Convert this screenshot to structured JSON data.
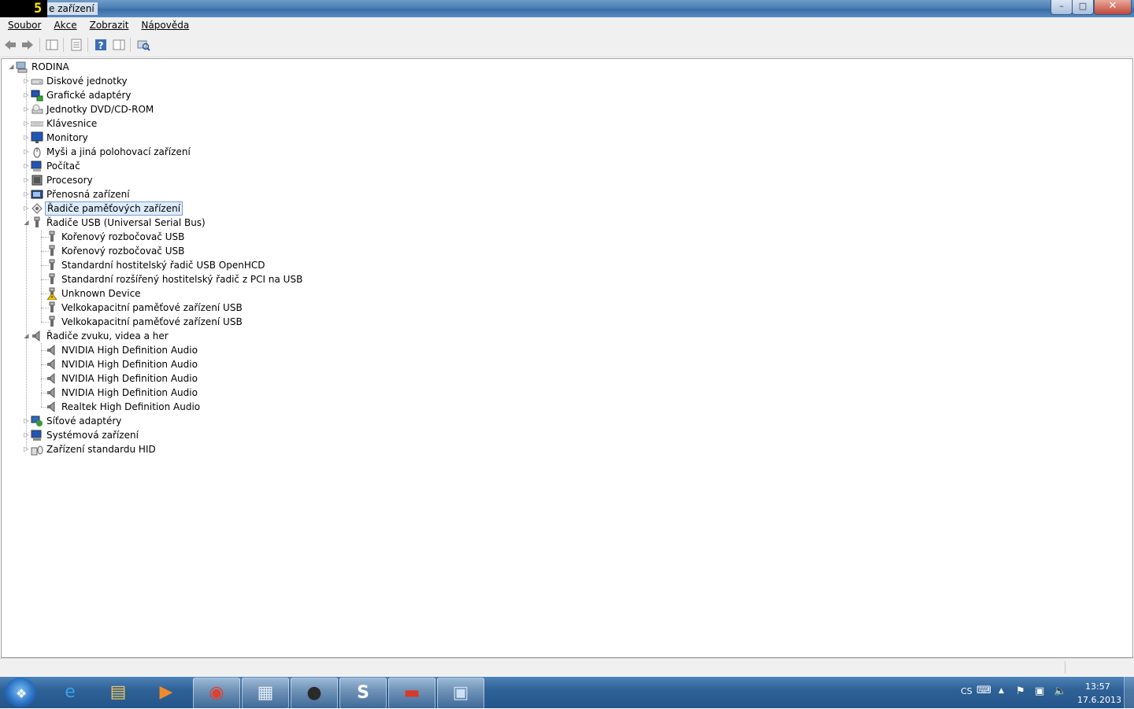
{
  "window": {
    "title": "e zařízení",
    "minimize_label": "–",
    "maximize_label": "□",
    "close_label": "✕"
  },
  "menu": [
    "Soubor",
    "Akce",
    "Zobrazit",
    "Nápověda"
  ],
  "toolbar_icons": [
    "back-arrow-icon",
    "forward-arrow-icon",
    "show-hide-console-tree-icon",
    "properties-icon",
    "help-icon",
    "action-pane-icon",
    "scan-hardware-changes-icon"
  ],
  "tree": {
    "root": "RODINA",
    "categories": [
      {
        "label": "Diskové jednotky",
        "icon": "disk-drive-icon",
        "expanded": false
      },
      {
        "label": "Grafické adaptéry",
        "icon": "display-adapter-icon",
        "expanded": false
      },
      {
        "label": "Jednotky DVD/CD-ROM",
        "icon": "dvd-drive-icon",
        "expanded": false
      },
      {
        "label": "Klávesnice",
        "icon": "keyboard-icon",
        "expanded": false
      },
      {
        "label": "Monitory",
        "icon": "monitor-icon",
        "expanded": false
      },
      {
        "label": "Myši a jiná polohovací zařízení",
        "icon": "mouse-icon",
        "expanded": false
      },
      {
        "label": "Počítač",
        "icon": "computer-icon",
        "expanded": false
      },
      {
        "label": "Procesory",
        "icon": "processor-icon",
        "expanded": false
      },
      {
        "label": "Přenosná zařízení",
        "icon": "portable-device-icon",
        "expanded": false
      },
      {
        "label": "Řadiče paměťových zařízení",
        "icon": "storage-controller-icon",
        "expanded": false,
        "selected": true
      },
      {
        "label": "Řadiče USB (Universal Serial Bus)",
        "icon": "usb-icon",
        "expanded": true,
        "children": [
          {
            "label": "Kořenový rozbočovač USB",
            "icon": "usb-icon"
          },
          {
            "label": "Kořenový rozbočovač USB",
            "icon": "usb-icon"
          },
          {
            "label": "Standardní hostitelský řadič  USB OpenHCD",
            "icon": "usb-icon"
          },
          {
            "label": "Standardní rozšířený hostitelský řadič z PCI na USB",
            "icon": "usb-icon"
          },
          {
            "label": "Unknown Device",
            "icon": "usb-warning-icon"
          },
          {
            "label": "Velkokapacitní paměťové zařízení USB",
            "icon": "usb-icon"
          },
          {
            "label": "Velkokapacitní paměťové zařízení USB",
            "icon": "usb-icon"
          }
        ]
      },
      {
        "label": "Řadiče zvuku, videa a her",
        "icon": "speaker-icon",
        "expanded": true,
        "children": [
          {
            "label": "NVIDIA High Definition Audio",
            "icon": "speaker-icon"
          },
          {
            "label": "NVIDIA High Definition Audio",
            "icon": "speaker-icon"
          },
          {
            "label": "NVIDIA High Definition Audio",
            "icon": "speaker-icon"
          },
          {
            "label": "NVIDIA High Definition Audio",
            "icon": "speaker-icon"
          },
          {
            "label": "Realtek High Definition Audio",
            "icon": "speaker-icon"
          }
        ]
      },
      {
        "label": "Síťové adaptéry",
        "icon": "network-adapter-icon",
        "expanded": false
      },
      {
        "label": "Systémová zařízení",
        "icon": "system-device-icon",
        "expanded": false
      },
      {
        "label": "Zařízení standardu HID",
        "icon": "hid-icon",
        "expanded": false
      }
    ]
  },
  "taskbar": {
    "apps": [
      {
        "name": "internet-explorer-icon",
        "active": false
      },
      {
        "name": "file-explorer-icon",
        "active": false
      },
      {
        "name": "media-player-icon",
        "active": false
      },
      {
        "name": "chrome-icon",
        "active": true
      },
      {
        "name": "document-viewer-icon",
        "active": true
      },
      {
        "name": "game-icon",
        "active": true
      },
      {
        "name": "skype-icon",
        "active": true
      },
      {
        "name": "toolbox-icon",
        "active": true
      },
      {
        "name": "device-manager-icon",
        "active": true
      }
    ],
    "language": "CS",
    "time": "13:57",
    "date": "17.6.2013"
  },
  "colors": {
    "selection_border": "#7da2ce",
    "selection_fill": "#ddecfd",
    "taskbar": "#2f6297",
    "close_button": "#c0473b"
  }
}
